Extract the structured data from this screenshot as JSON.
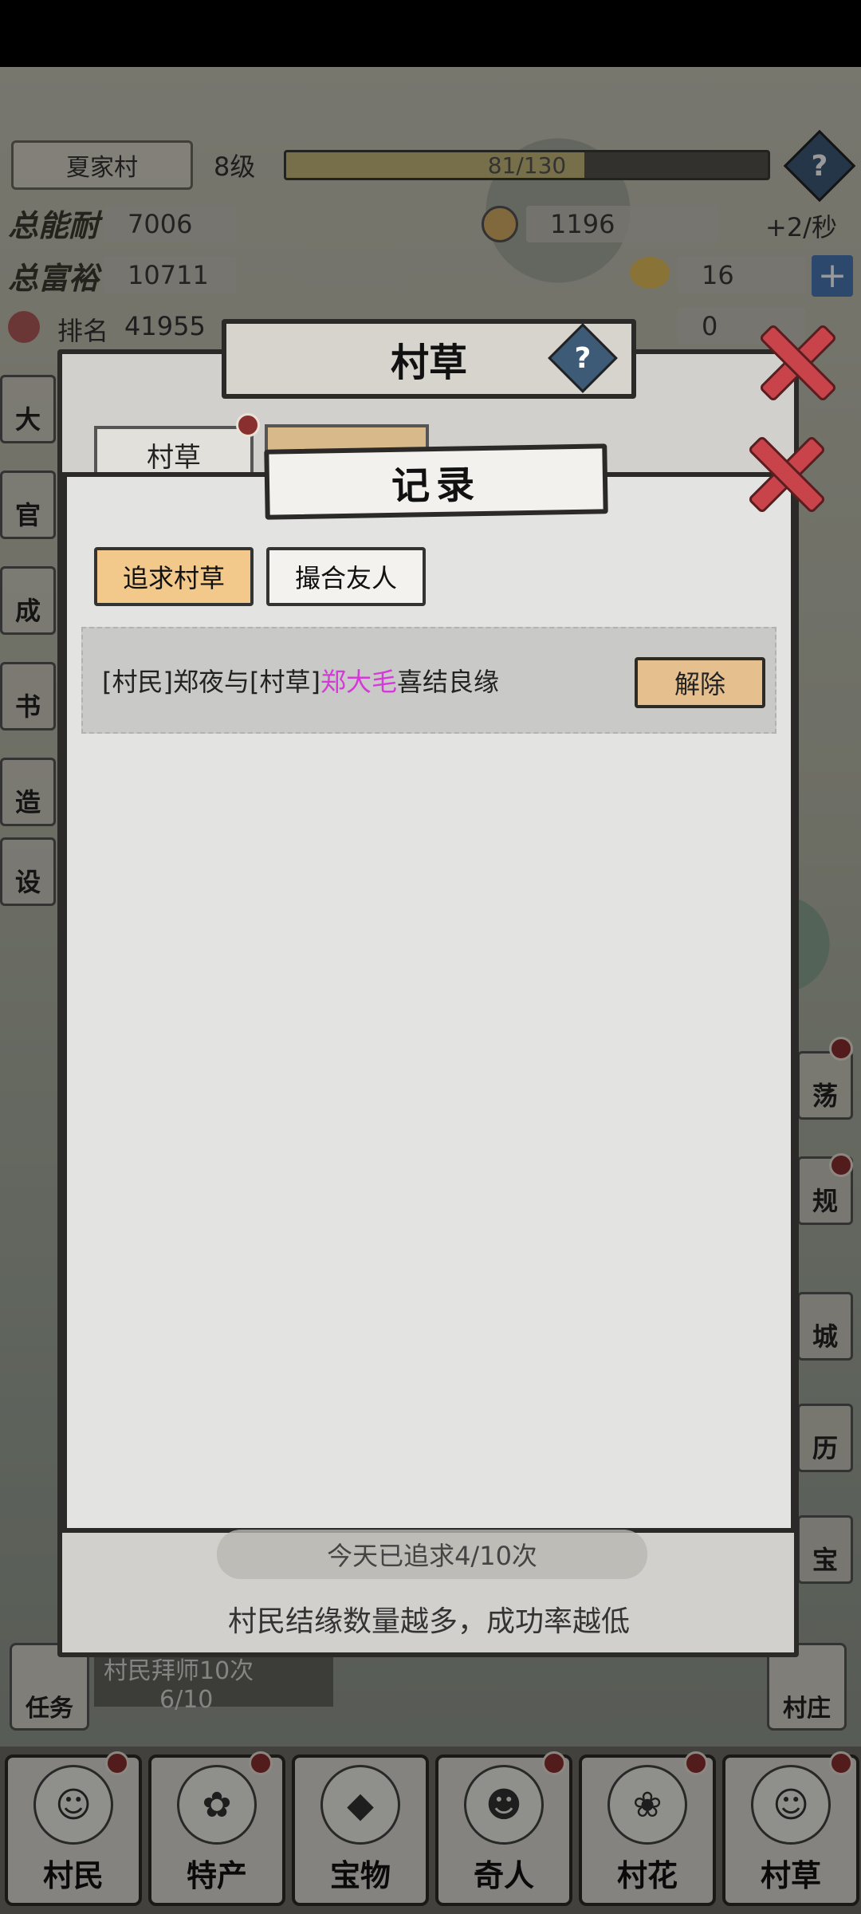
{
  "hud": {
    "village_name": "夏家村",
    "level": "8级",
    "exp_text": "81/130",
    "exp_fraction": 0.62,
    "stat1_label": "总能耐",
    "stat1_value": "7006",
    "stat2_label": "总富裕",
    "stat2_value": "10711",
    "rank_label": "排名",
    "rank_value": "41955",
    "coins": "1196",
    "coin_rate": "+2/秒",
    "ingots": "16",
    "third_resource": "0"
  },
  "outer_dialog": {
    "title": "村草",
    "tab1": "村草"
  },
  "record_dialog": {
    "title": "记录",
    "tabs": [
      "追求村草",
      "撮合友人"
    ],
    "records": [
      {
        "prefix": "[村民]郑夜与[村草]",
        "highlight": "郑大毛",
        "suffix": "喜结良缘",
        "action": "解除"
      }
    ]
  },
  "daily_count": "今天已追求4/10次",
  "hint": "村民结缘数量越多，成功率越低",
  "quest": {
    "label": "任务",
    "text": "村民拜师10次",
    "progress": "6/10"
  },
  "right_corner": "村庄",
  "side_right": [
    "荡",
    "规",
    "城",
    "历",
    "宝"
  ],
  "side_left": [
    "大",
    "官",
    "成",
    "书",
    "造",
    "设"
  ],
  "nav": [
    {
      "label": "村民",
      "icon": "villager-icon"
    },
    {
      "label": "特产",
      "icon": "specialty-icon"
    },
    {
      "label": "宝物",
      "icon": "treasure-icon"
    },
    {
      "label": "奇人",
      "icon": "stranger-icon"
    },
    {
      "label": "村花",
      "icon": "village-belle-icon"
    },
    {
      "label": "村草",
      "icon": "village-hunk-icon"
    }
  ],
  "colors": {
    "highlight_name": "#d43ad7",
    "tab_active": "#f2c98a",
    "close_red": "#c8444a"
  }
}
